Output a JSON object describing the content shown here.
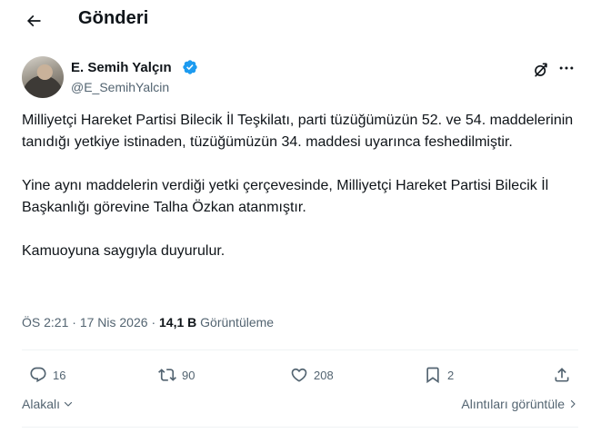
{
  "header": {
    "title": "Gönderi"
  },
  "author": {
    "name": "E. Semih Yalçın",
    "handle": "@E_SemihYalcin",
    "verified_color": "#1d9bf0"
  },
  "tweet": {
    "paragraphs": [
      "Milliyetçi Hareket Partisi Bilecik İl Teşkilatı, parti tüzüğümüzün 52. ve 54. maddelerinin tanıdığı yetkiye istinaden, tüzüğümüzün 34. maddesi uyarınca feshedilmiştir.",
      "Yine aynı maddelerin verdiği yetki çerçevesinde, Milliyetçi Hareket Partisi Bilecik İl Başkanlığı görevine Talha Özkan atanmıştır.",
      "Kamuoyuna saygıyla duyurulur."
    ]
  },
  "meta": {
    "time": "ÖS 2:21",
    "date": "17 Nis 2026",
    "separator": "·",
    "views_count": "14,1 B",
    "views_label": "Görüntüleme"
  },
  "actions": {
    "replies": "16",
    "reposts": "90",
    "likes": "208",
    "bookmarks": "2"
  },
  "footer": {
    "sort_label": "Alakalı",
    "quotes_label": "Alıntıları görüntüle"
  },
  "icons": {
    "back": "arrow-left-icon",
    "verified": "verified-badge-icon",
    "grok": "grok-icon",
    "more": "more-icon",
    "reply": "reply-icon",
    "repost": "repost-icon",
    "like": "like-icon",
    "bookmark": "bookmark-icon",
    "share": "share-icon"
  },
  "colors": {
    "text": "#0f1419",
    "secondary": "#536471",
    "border": "#eff3f4",
    "accent": "#1d9bf0"
  }
}
